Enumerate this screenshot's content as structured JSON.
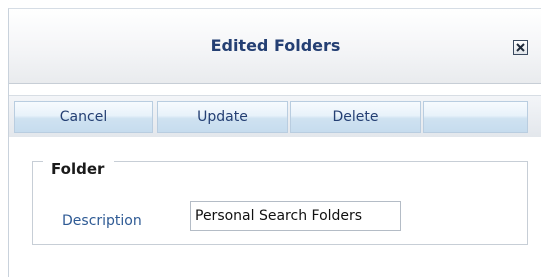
{
  "dialog": {
    "title": "Edited Folders",
    "close_icon": "close-x-icon"
  },
  "toolbar": {
    "cancel_label": "Cancel",
    "update_label": "Update",
    "delete_label": "Delete"
  },
  "form": {
    "group_legend": "Folder",
    "description_label": "Description",
    "description_value": "Personal Search Folders"
  },
  "colors": {
    "title_text": "#243f73",
    "button_face": "#c6dcee",
    "field_label": "#2e5a94"
  }
}
